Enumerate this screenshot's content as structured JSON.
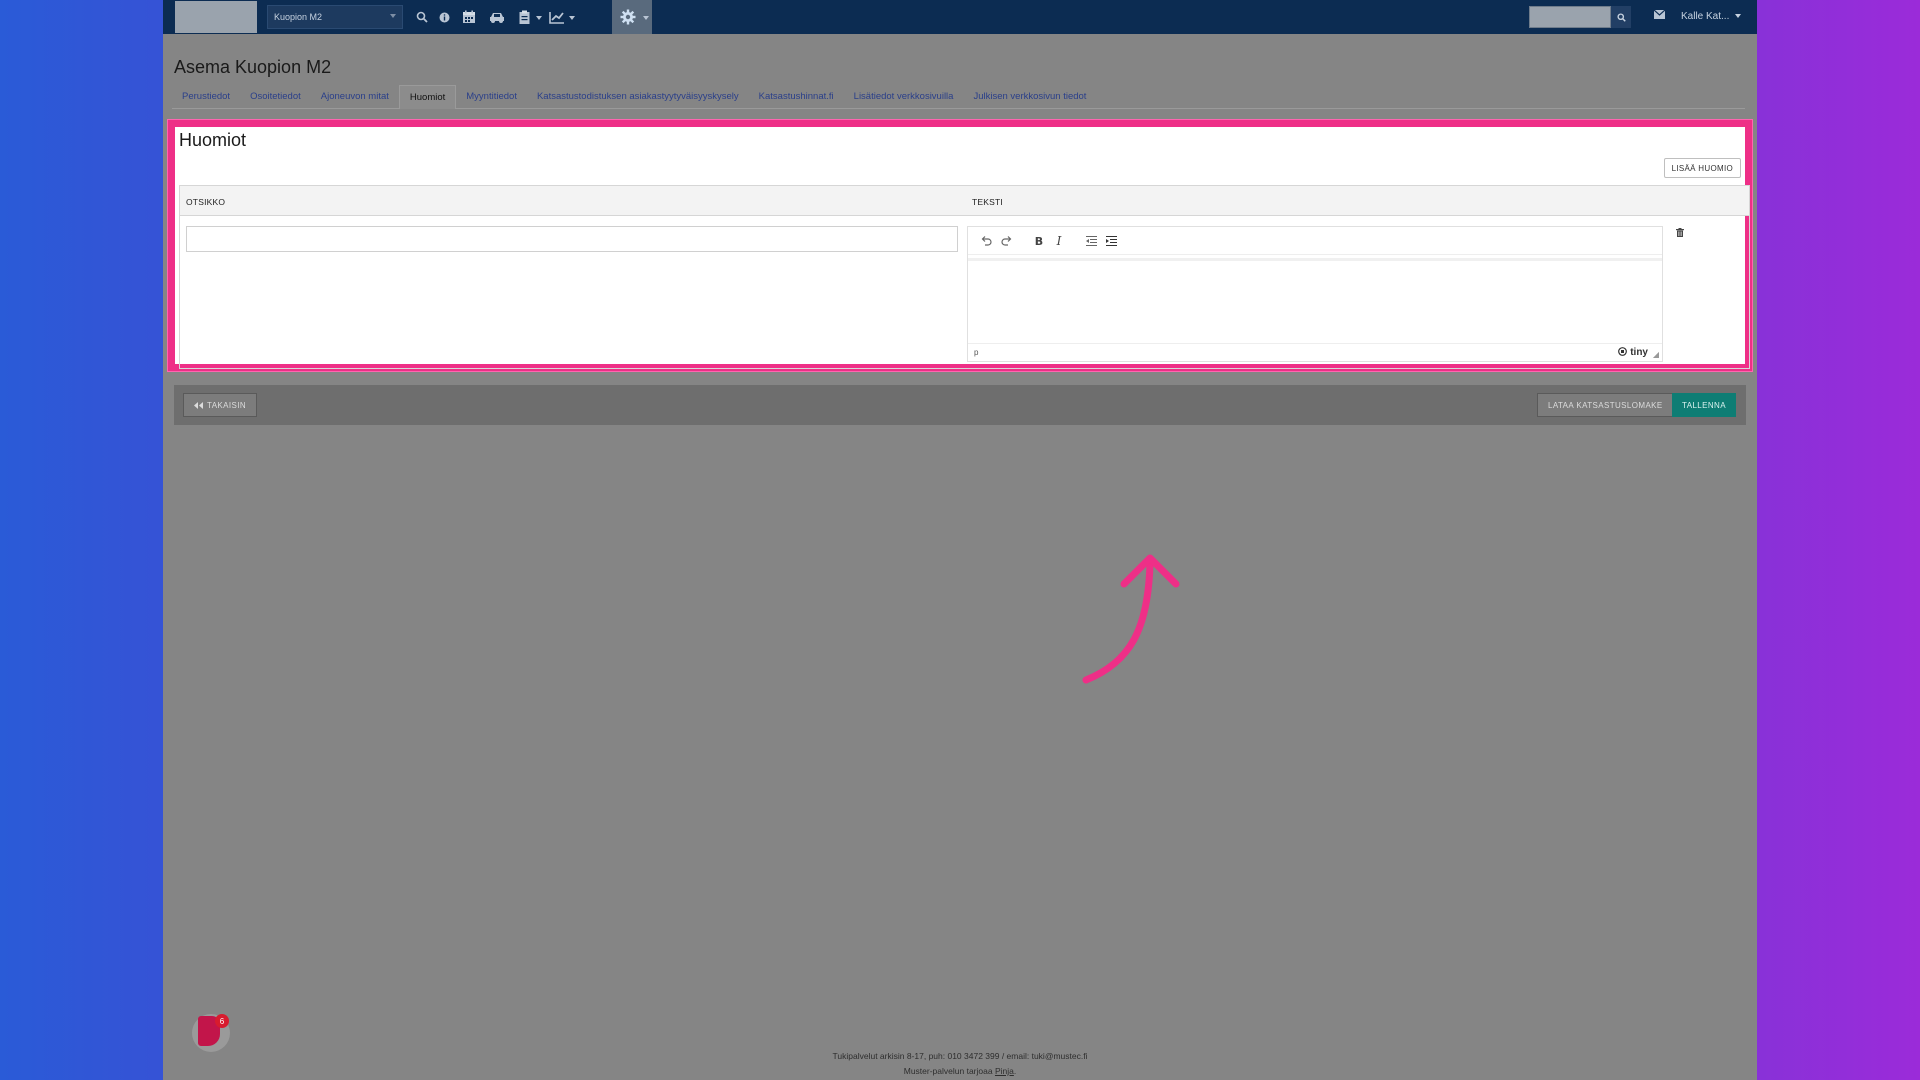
{
  "topbar": {
    "station_select": "Kuopion M2",
    "user_menu": "Kalle Kat..."
  },
  "page": {
    "title": "Asema Kuopion M2"
  },
  "tabs": [
    {
      "label": "Perustiedot"
    },
    {
      "label": "Osoitetiedot"
    },
    {
      "label": "Ajoneuvon mitat"
    },
    {
      "label": "Huomiot"
    },
    {
      "label": "Myyntitiedot"
    },
    {
      "label": "Katsastustodistuksen asiakastyytyväisyyskysely"
    },
    {
      "label": "Katsastushinnat.fi"
    },
    {
      "label": "Lisätiedot verkkosivuilla"
    },
    {
      "label": "Julkisen verkkosivun tiedot"
    }
  ],
  "panel": {
    "title": "Huomiot",
    "add_button": "LISÄÄ HUOMIO",
    "columns": {
      "title": "OTSIKKO",
      "text": "TEKSTI"
    },
    "editor": {
      "path": "p",
      "brand": "tiny"
    }
  },
  "actions": {
    "back": "TAKAISIN",
    "download_form": "LATAA KATSASTUSLOMAKE",
    "save": "TALLENNA"
  },
  "badge": {
    "count": "6"
  },
  "footer": {
    "support": "Tukipalvelut arkisin 8-17, puh: 010 3472 399 / email: tuki@mustec.fi",
    "provider_prefix": "Muster-palvelun tarjoaa",
    "provider_link": "Pinja",
    "provider_suffix": "."
  },
  "colors": {
    "highlight": "#ee2f87",
    "topbar": "#0c2c52",
    "save": "#0e7d74"
  }
}
